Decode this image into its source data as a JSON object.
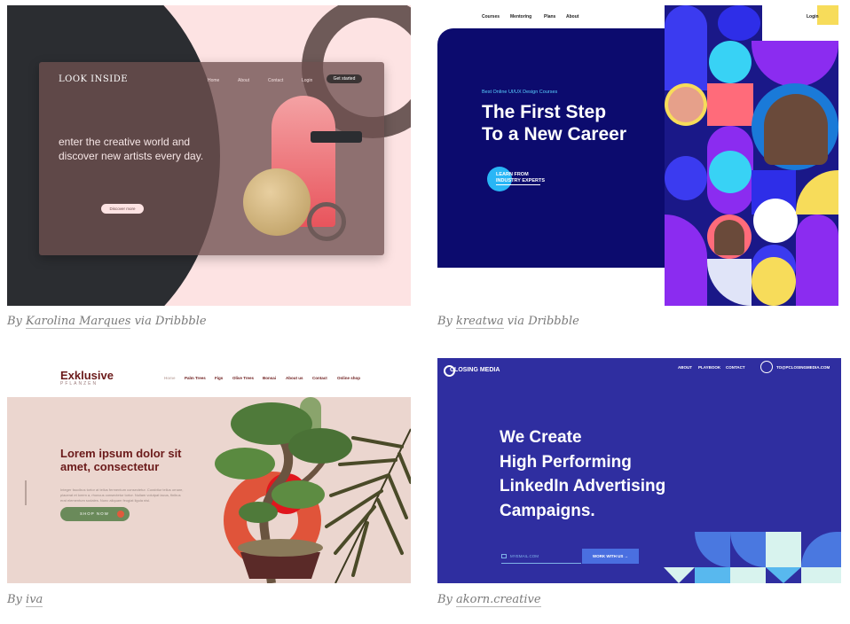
{
  "cards": [
    {
      "logo": "LOOK INSIDE",
      "nav": [
        "Home",
        "About",
        "Contact",
        "Login"
      ],
      "cta": "Get started",
      "hero": "enter the creative world and discover new artists every day.",
      "button": "Discover more",
      "caption": {
        "by": "By ",
        "author": "Karolina Marques",
        "via": " via Dribbble"
      }
    },
    {
      "nav": [
        "Courses",
        "Mentoring",
        "Plans",
        "About"
      ],
      "login": "Login",
      "eyebrow": "Best Online UI/UX Design Courses",
      "heading_line1": "The First Step",
      "heading_line2": "To a New Career",
      "learn_line1": "LEARN FROM",
      "learn_line2": "INDUSTRY EXPERTS",
      "caption": {
        "by": "By ",
        "author": "kreatwa",
        "via": " via Dribbble"
      }
    },
    {
      "brand": "Exklusive",
      "brand_sub": "PFLANZEN",
      "nav": [
        "Home",
        "Palm Trees",
        "Figs",
        "Olive Trees",
        "Bonsai",
        "About us",
        "Contact",
        "Online shop"
      ],
      "hero": "Lorem ipsum dolor sit amet, consectetur",
      "body": "Integer faucibus tortor at tellus fermentum consectetur. Curabitur tellus ornare, placerat et lorem a, rhoncus consectetur tortor. Nullam volutpat lacus, finibus erat elementum sodales. Nunc aliquam feugiat ligula nisi.",
      "button": "SHOP NOW",
      "caption": {
        "by": "By ",
        "author": "iva",
        "via": ""
      }
    },
    {
      "logo": "CLOSING MEDIA",
      "nav": [
        "ABOUT",
        "PLAYBOOK",
        "CONTACT"
      ],
      "email": "TO@PCLOSINGMEDIA.COM",
      "heading": [
        "We Create",
        "High Performing",
        "LinkedIn Advertising",
        "Campaigns."
      ],
      "input_placeholder": "MYEMAIL.COM",
      "button": "WORK WITH US  →",
      "caption": {
        "by": "By ",
        "author": "akorn.creative",
        "via": ""
      }
    }
  ],
  "colors": {
    "card1_bg": "#fde3e3",
    "card2_navy": "#0c0b6e",
    "card3_text": "#6b1a1a",
    "card4_bg": "#2f2ea0"
  }
}
